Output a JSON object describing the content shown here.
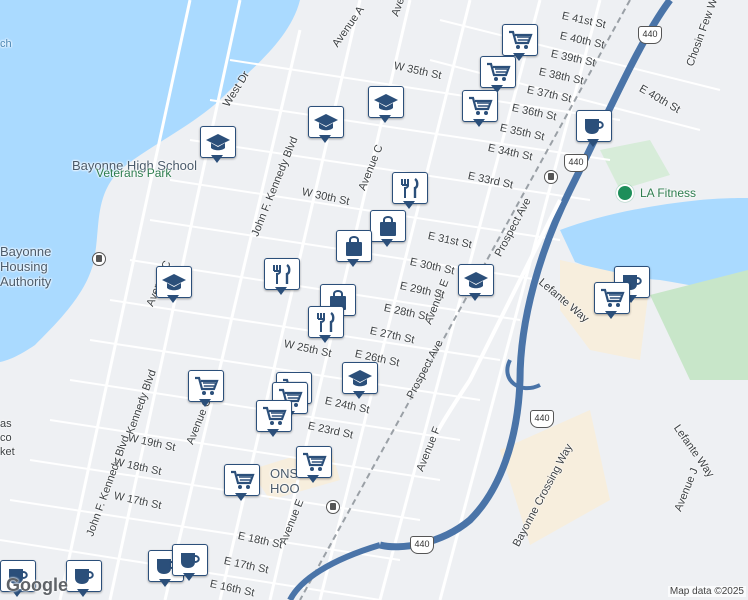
{
  "map": {
    "provider_logo": "Google",
    "attribution": "Map data ©2025",
    "colors": {
      "water": "#aadaff",
      "park": "#c8e6c9",
      "land": "#eef0f3",
      "road": "#ffffff",
      "highway": "#4a74a8",
      "commercial": "#f7eedd",
      "pin_border": "#2b4f7a"
    }
  },
  "places": [
    {
      "id": "high-school",
      "text": "Bayonne High School"
    },
    {
      "id": "veterans-park",
      "text": "Veterans Park"
    },
    {
      "id": "housing-authority",
      "text": "Bayonne Housing Authority"
    },
    {
      "id": "la-fitness",
      "text": "LA Fitness"
    },
    {
      "id": "ch-partial",
      "text": "ch"
    },
    {
      "id": "cons-partial",
      "text": "ONS"
    },
    {
      "id": "hook-partial",
      "text": "HOO"
    },
    {
      "id": "ket-partial",
      "text": "ket"
    },
    {
      "id": "co-partial",
      "text": "co"
    },
    {
      "id": "as-partial",
      "text": "as"
    }
  ],
  "streets": [
    "Avenue A",
    "Avenue B",
    "Avenue C",
    "Avenue C",
    "Avenue C",
    "Avenue E",
    "Avenue E",
    "Avenue F",
    "Avenue J",
    "John F. Kennedy Blvd",
    "John F. Kennedy Blvd",
    "Kennedy Blvd",
    "West Dr",
    "W 35th St",
    "W 30th St",
    "W 25th St",
    "W 19th St",
    "W 18th St",
    "W 17th St",
    "E 41st St",
    "E 40th St",
    "E 39th St",
    "E 38th St",
    "E 37th St",
    "E 36th St",
    "E 35th St",
    "E 34th St",
    "E 33rd St",
    "E 31st St",
    "E 30th St",
    "E 29th St",
    "E 28th St",
    "E 27th St",
    "E 26th St",
    "E 24th St",
    "E 23rd St",
    "E 18th St",
    "E 17th St",
    "E 16th St",
    "E 40th St",
    "Prospect Ave",
    "Prospect Ave",
    "Lefante Way",
    "Lefante Way",
    "Bayonne Crossing Way",
    "Chosin Few Way"
  ],
  "route_shields": [
    "440",
    "440",
    "440",
    "440"
  ],
  "pins": [
    "cart-icon",
    "cart-icon",
    "cart-icon",
    "graduation-cap-icon",
    "graduation-cap-icon",
    "graduation-cap-icon",
    "coffee-cup-icon",
    "graduation-cap-icon",
    "fork-knife-icon",
    "shopping-bag-icon",
    "shopping-bag-icon",
    "fork-knife-icon",
    "graduation-cap-icon",
    "shopping-bag-icon",
    "fork-knife-icon",
    "graduation-cap-icon",
    "cart-icon",
    "cart-icon",
    "cart-icon",
    "cart-icon",
    "cart-icon",
    "cart-icon",
    "coffee-cup-icon",
    "cart-icon",
    "coffee-cup-icon",
    "coffee-cup-icon",
    "coffee-cup-icon",
    "coffee-cup-icon"
  ]
}
